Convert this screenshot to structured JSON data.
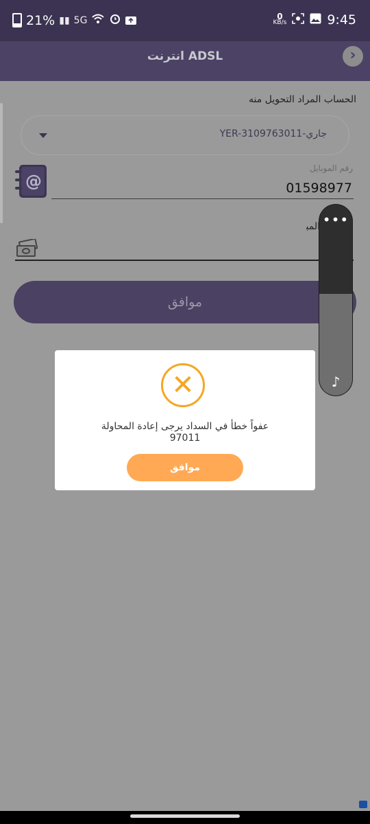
{
  "status_bar": {
    "battery": "21%",
    "signal_label": "5G",
    "speed_value": "0",
    "speed_unit": "KB/s",
    "time": "9:45"
  },
  "app_bar": {
    "title": "انترنت ADSL"
  },
  "form": {
    "from_account_label": "الحساب المراد التحويل منه",
    "account_value": "YER-3109763011-جاري",
    "mobile_label": "رقم الموبايل",
    "mobile_value": "01598977",
    "amount_label": "المبلغ",
    "submit_label": "موافق"
  },
  "dialog": {
    "message_line1": "عفواً خطأ في السداد يرجى إعادة المحاولة",
    "message_line2": "97011",
    "ok_label": "موافق"
  },
  "float_panel": {
    "more_icon": "more-dots-icon",
    "music_icon": "music-note-icon"
  },
  "colors": {
    "primary": "#4b4265",
    "accent": "#f5a623",
    "ok_button": "#ffa954"
  }
}
